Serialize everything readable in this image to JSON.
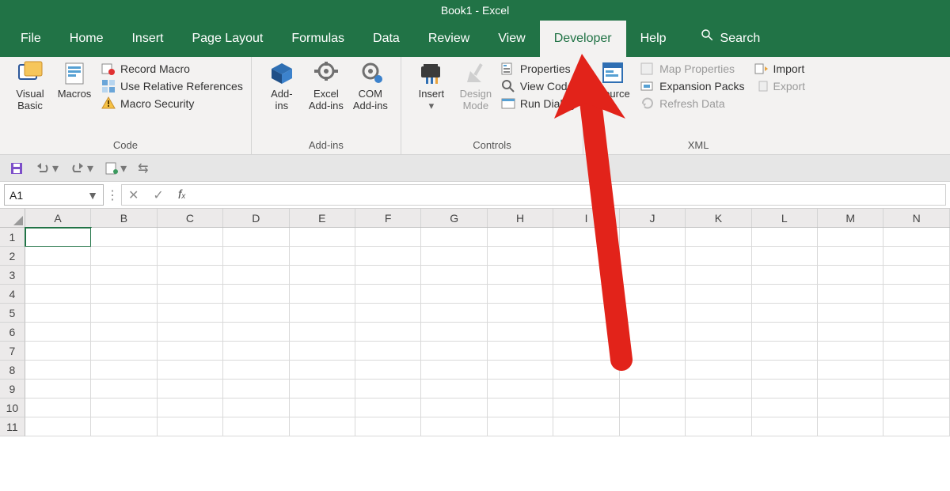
{
  "title": "Book1  -  Excel",
  "tabs": {
    "file": "File",
    "home": "Home",
    "insert": "Insert",
    "page_layout": "Page Layout",
    "formulas": "Formulas",
    "data": "Data",
    "review": "Review",
    "view": "View",
    "developer": "Developer",
    "help": "Help",
    "search": "Search"
  },
  "ribbon": {
    "code": {
      "visual_basic": "Visual\nBasic",
      "macros": "Macros",
      "record_macro": "Record Macro",
      "use_relative": "Use Relative References",
      "macro_security": "Macro Security",
      "label": "Code"
    },
    "addins": {
      "addins": "Add-\nins",
      "excel_addins": "Excel\nAdd-ins",
      "com_addins": "COM\nAdd-ins",
      "label": "Add-ins"
    },
    "controls": {
      "insert": "Insert",
      "design_mode": "Design\nMode",
      "properties": "Properties",
      "view_code": "View Code",
      "run_dialog": "Run Dialog",
      "label": "Controls"
    },
    "xml": {
      "source": "Source",
      "map_properties": "Map Properties",
      "expansion_packs": "Expansion Packs",
      "refresh_data": "Refresh Data",
      "import": "Import",
      "export": "Export",
      "label": "XML"
    }
  },
  "namebox": "A1",
  "columns": [
    "A",
    "B",
    "C",
    "D",
    "E",
    "F",
    "G",
    "H",
    "I",
    "J",
    "K",
    "L",
    "M",
    "N"
  ],
  "rows": [
    "1",
    "2",
    "3",
    "4",
    "5",
    "6",
    "7",
    "8",
    "9",
    "10",
    "11"
  ]
}
